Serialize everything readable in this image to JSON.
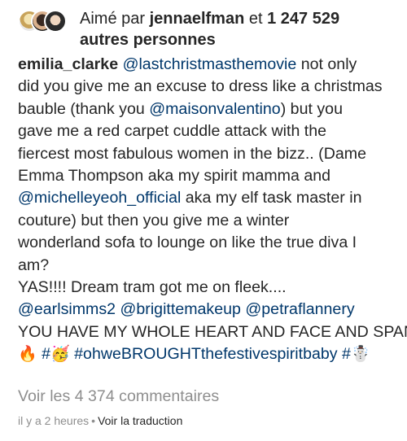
{
  "likes": {
    "prefix": "Aimé par",
    "user": "jennaelfman",
    "connector": "et",
    "count": "1 247 529",
    "suffix": "autres personnes"
  },
  "caption": {
    "username": "emilia_clarke",
    "l1_mention": "@lastchristmasthemovie",
    "l1_text": " not only",
    "l2": "did you give me an excuse to dress like a christmas",
    "l3_a": "bauble (thank you ",
    "l3_mention": "@maisonvalentino",
    "l3_b": ") but you",
    "l4": "gave me a red carpet cuddle attack with the",
    "l5": "fiercest most fabulous women in the bizz.. (Dame",
    "l6": "Emma Thompson aka my spirit mamma and",
    "l7_mention": "@michelleyeoh_official",
    "l7_text": " aka my elf task master in",
    "l8": "couture) but then you give me a winter",
    "l9": "wonderland sofa to lounge on like the true diva I",
    "l10": "am?",
    "l11": "YAS!!!! Dream tram got me on fleek....",
    "l12_m1": "@earlsimms2",
    "l12_m2": "@brigittemakeup",
    "l12_m3": "@petraflannery",
    "l13": "YOU HAVE MY WHOLE HEART AND FACE AND SPAN",
    "l14_emoji1": "🔥",
    "l14_tag1": "#",
    "l14_emoji2": "🥳",
    "l14_tag2": "#ohweBROUGHTthefestivespiritbaby",
    "l14_tag3": "#",
    "l14_emoji3": "☃️"
  },
  "view_comments": "Voir les 4 374 commentaires",
  "meta": {
    "time": "il y a 2 heures",
    "separator": "•",
    "translate": "Voir la traduction"
  }
}
